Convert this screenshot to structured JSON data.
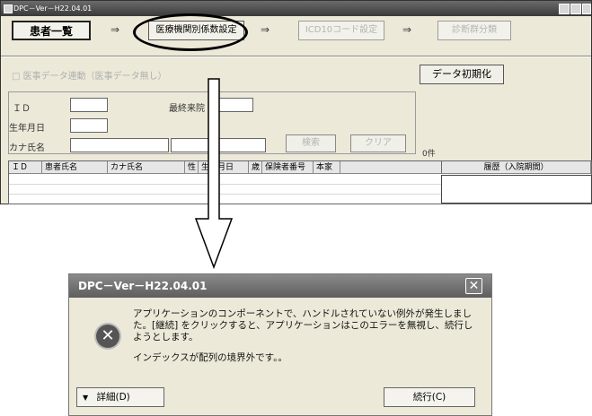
{
  "app": {
    "title": "DPC－Ver－H22.04.01",
    "tabs": [
      {
        "label": "患者一覧"
      },
      {
        "label": "医療機関別係数設定"
      },
      {
        "label": "ICD10コード設定"
      },
      {
        "label": "診断群分類"
      }
    ],
    "arrow_glyph": "⇒",
    "sync_label": "医事データ連動（医事データ無し）",
    "init_button": "データ初期化",
    "search": {
      "id_label": "ＩＤ",
      "last_visit_label": "最終来院",
      "dob_label": "生年月日",
      "kana_label": "カナ氏名",
      "search_button": "検索",
      "clear_button": "クリア",
      "count": "0件"
    },
    "grid_columns": [
      "ＩＤ",
      "患者氏名",
      "カナ氏名",
      "性",
      "生年月日",
      "歳",
      "保険者番号",
      "本家"
    ],
    "history_header": "履歴（入院期間）"
  },
  "dialog": {
    "title": "DPC－Ver－H22.04.01",
    "close_glyph": "✕",
    "error_glyph": "✕",
    "message_lines": [
      "アプリケーションのコンポーネントで、ハンドルされていない例外が発生しまし",
      "た。[継続] をクリックすると、アプリケーションはこのエラーを無視し、続行し",
      "ようとします。"
    ],
    "detail_message": "インデックスが配列の境界外です。。",
    "details_button": "詳細(D)",
    "details_glyph": "▼",
    "continue_button": "続行(C)"
  }
}
